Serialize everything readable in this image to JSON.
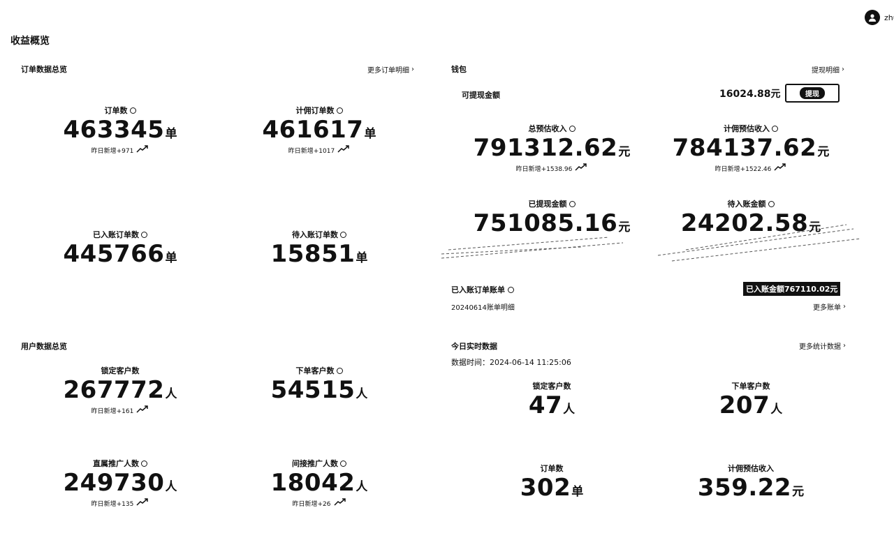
{
  "user": {
    "name": "zhu"
  },
  "page_title": "收益概览",
  "order_section": {
    "title": "订单数据总览",
    "more_link": "更多订单明细",
    "stats": [
      {
        "label": "订单数",
        "value": "463345",
        "unit": "单",
        "yesterday": "昨日新增+971"
      },
      {
        "label": "计佣订单数",
        "value": "461617",
        "unit": "单",
        "yesterday": "昨日新增+1017"
      },
      {
        "label": "已入账订单数",
        "value": "445766",
        "unit": "单"
      },
      {
        "label": "待入账订单数",
        "value": "15851",
        "unit": "单"
      }
    ]
  },
  "wallet": {
    "title": "钱包",
    "more_link": "提现明细",
    "withdrawable_label": "可提现金额",
    "withdrawable_amount": "16024.88元",
    "withdraw_button": "提现",
    "stats": [
      {
        "label": "总预估收入",
        "value": "791312.62",
        "unit": "元",
        "yesterday": "昨日新增+1538.96"
      },
      {
        "label": "计佣预估收入",
        "value": "784137.62",
        "unit": "元",
        "yesterday": "昨日新增+1522.46"
      },
      {
        "label": "已提现金额",
        "value": "751085.16",
        "unit": "元"
      },
      {
        "label": "待入账金额",
        "value": "24202.58",
        "unit": "元"
      }
    ]
  },
  "settled_bill": {
    "title": "已入账订单账单",
    "badge": "已入账金额767110.02元",
    "detail": "20240614账单明细",
    "more_link": "更多账单"
  },
  "user_section": {
    "title": "用户数据总览",
    "stats": [
      {
        "label": "锁定客户数",
        "value": "267772",
        "unit": "人",
        "yesterday": "昨日新增+161"
      },
      {
        "label": "下单客户数",
        "value": "54515",
        "unit": "人"
      },
      {
        "label": "直属推广人数",
        "value": "249730",
        "unit": "人",
        "yesterday": "昨日新增+135"
      },
      {
        "label": "间接推广人数",
        "value": "18042",
        "unit": "人",
        "yesterday": "昨日新增+26"
      }
    ]
  },
  "realtime": {
    "title": "今日实时数据",
    "more_link": "更多统计数据",
    "time_label": "数据时间：",
    "time_value": "2024-06-14 11:25:06",
    "stats": [
      {
        "label": "锁定客户数",
        "value": "47",
        "unit": "人"
      },
      {
        "label": "下单客户数",
        "value": "207",
        "unit": "人"
      },
      {
        "label": "订单数",
        "value": "302",
        "unit": "单"
      },
      {
        "label": "计佣预估收入",
        "value": "359.22",
        "unit": "元"
      }
    ]
  }
}
